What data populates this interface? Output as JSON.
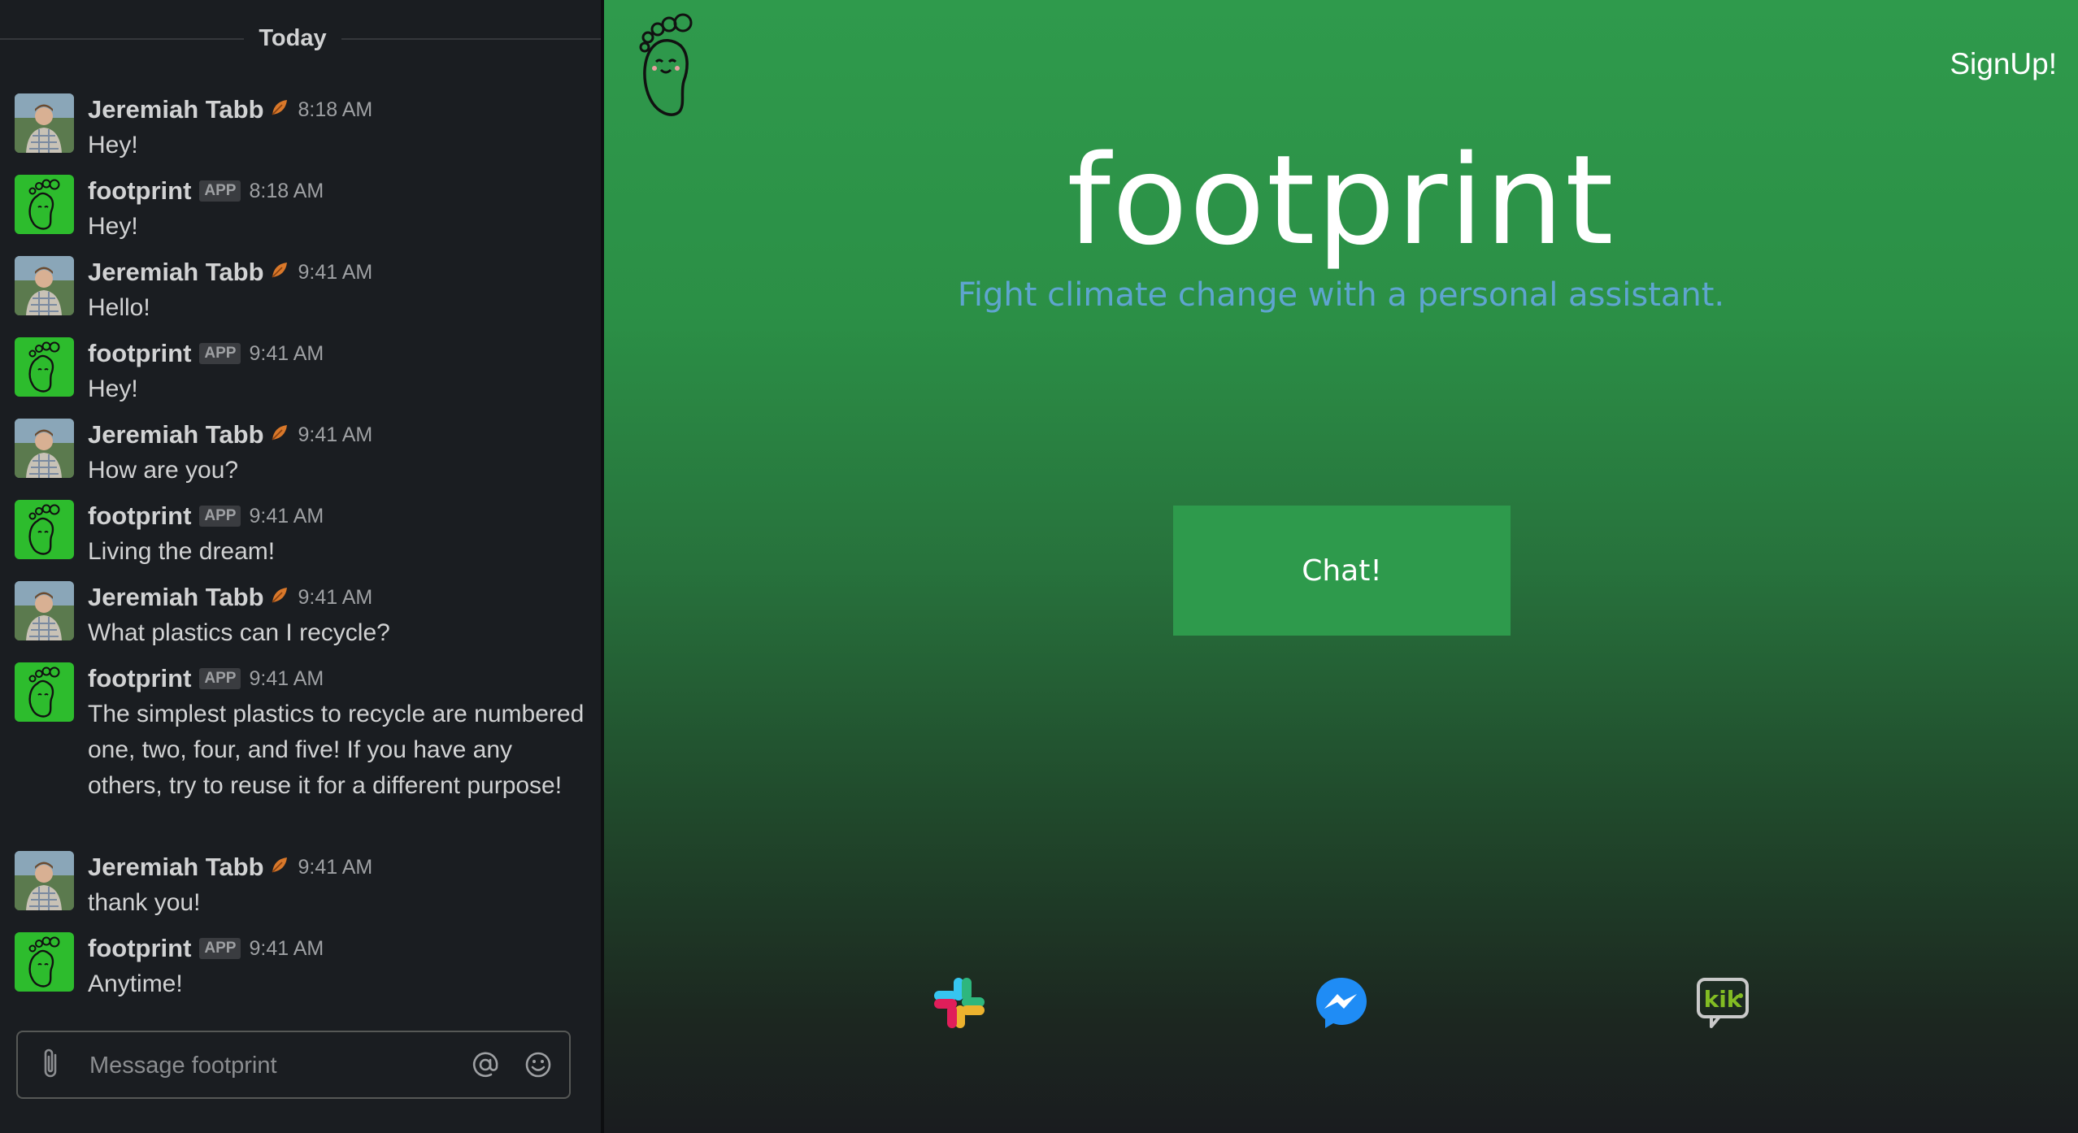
{
  "slack": {
    "date_divider": "Today",
    "messages": [
      {
        "author": "Jeremiah Tabb",
        "is_app": false,
        "time": "8:18 AM",
        "text": "Hey!"
      },
      {
        "author": "footprint",
        "is_app": true,
        "app_badge": "APP",
        "time": "8:18 AM",
        "text": "Hey!"
      },
      {
        "author": "Jeremiah Tabb",
        "is_app": false,
        "time": "9:41 AM",
        "text": "Hello!"
      },
      {
        "author": "footprint",
        "is_app": true,
        "app_badge": "APP",
        "time": "9:41 AM",
        "text": "Hey!"
      },
      {
        "author": "Jeremiah Tabb",
        "is_app": false,
        "time": "9:41 AM",
        "text": "How are you?"
      },
      {
        "author": "footprint",
        "is_app": true,
        "app_badge": "APP",
        "time": "9:41 AM",
        "text": "Living the dream!"
      },
      {
        "author": "Jeremiah Tabb",
        "is_app": false,
        "time": "9:41 AM",
        "text": "What plastics can I recycle?"
      },
      {
        "author": "footprint",
        "is_app": true,
        "app_badge": "APP",
        "time": "9:41 AM",
        "text": "The simplest plastics to recycle are numbered one, two, four, and five! If you have any others, try to reuse it for a different purpose!"
      },
      {
        "author": "Jeremiah Tabb",
        "is_app": false,
        "time": "9:41 AM",
        "text": "thank you!"
      },
      {
        "author": "footprint",
        "is_app": true,
        "app_badge": "APP",
        "time": "9:41 AM",
        "text": "Anytime!"
      }
    ],
    "composer": {
      "placeholder": "Message footprint",
      "icons": [
        "paperclip-icon",
        "mention-icon",
        "emoji-icon"
      ]
    }
  },
  "site": {
    "signup_label": "SignUp!",
    "title": "footprint",
    "tagline": "Fight climate change with a personal assistant.",
    "chat_button_label": "Chat!",
    "platforms": [
      "slack-icon",
      "messenger-icon",
      "kik-icon"
    ],
    "colors": {
      "accent_green": "#2e9a4c",
      "tagline_blue": "#5fa5cf",
      "bot_avatar_green": "#2dbc2d"
    }
  }
}
